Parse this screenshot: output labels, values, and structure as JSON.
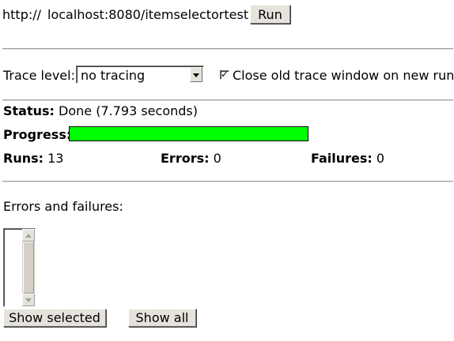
{
  "url_bar": {
    "protocol": "http://",
    "url_value": "localhost:8080/itemselectortest",
    "run_label": "Run"
  },
  "trace": {
    "label": "Trace level:",
    "selected_option": "no tracing",
    "close_checkbox_checked": true,
    "close_checkbox_label": "Close old trace window on new run"
  },
  "status": {
    "label": "Status:",
    "value": "Done (7.793 seconds)"
  },
  "progress": {
    "label": "Progress:",
    "percent": 100,
    "fill_color": "#00ff00"
  },
  "stats": {
    "runs_label": "Runs:",
    "runs_value": "13",
    "errors_label": "Errors:",
    "errors_value": "0",
    "failures_label": "Failures:",
    "failures_value": "0"
  },
  "errors_section": {
    "heading": "Errors and failures:",
    "items": [],
    "show_selected_label": "Show selected",
    "show_all_label": "Show all"
  }
}
